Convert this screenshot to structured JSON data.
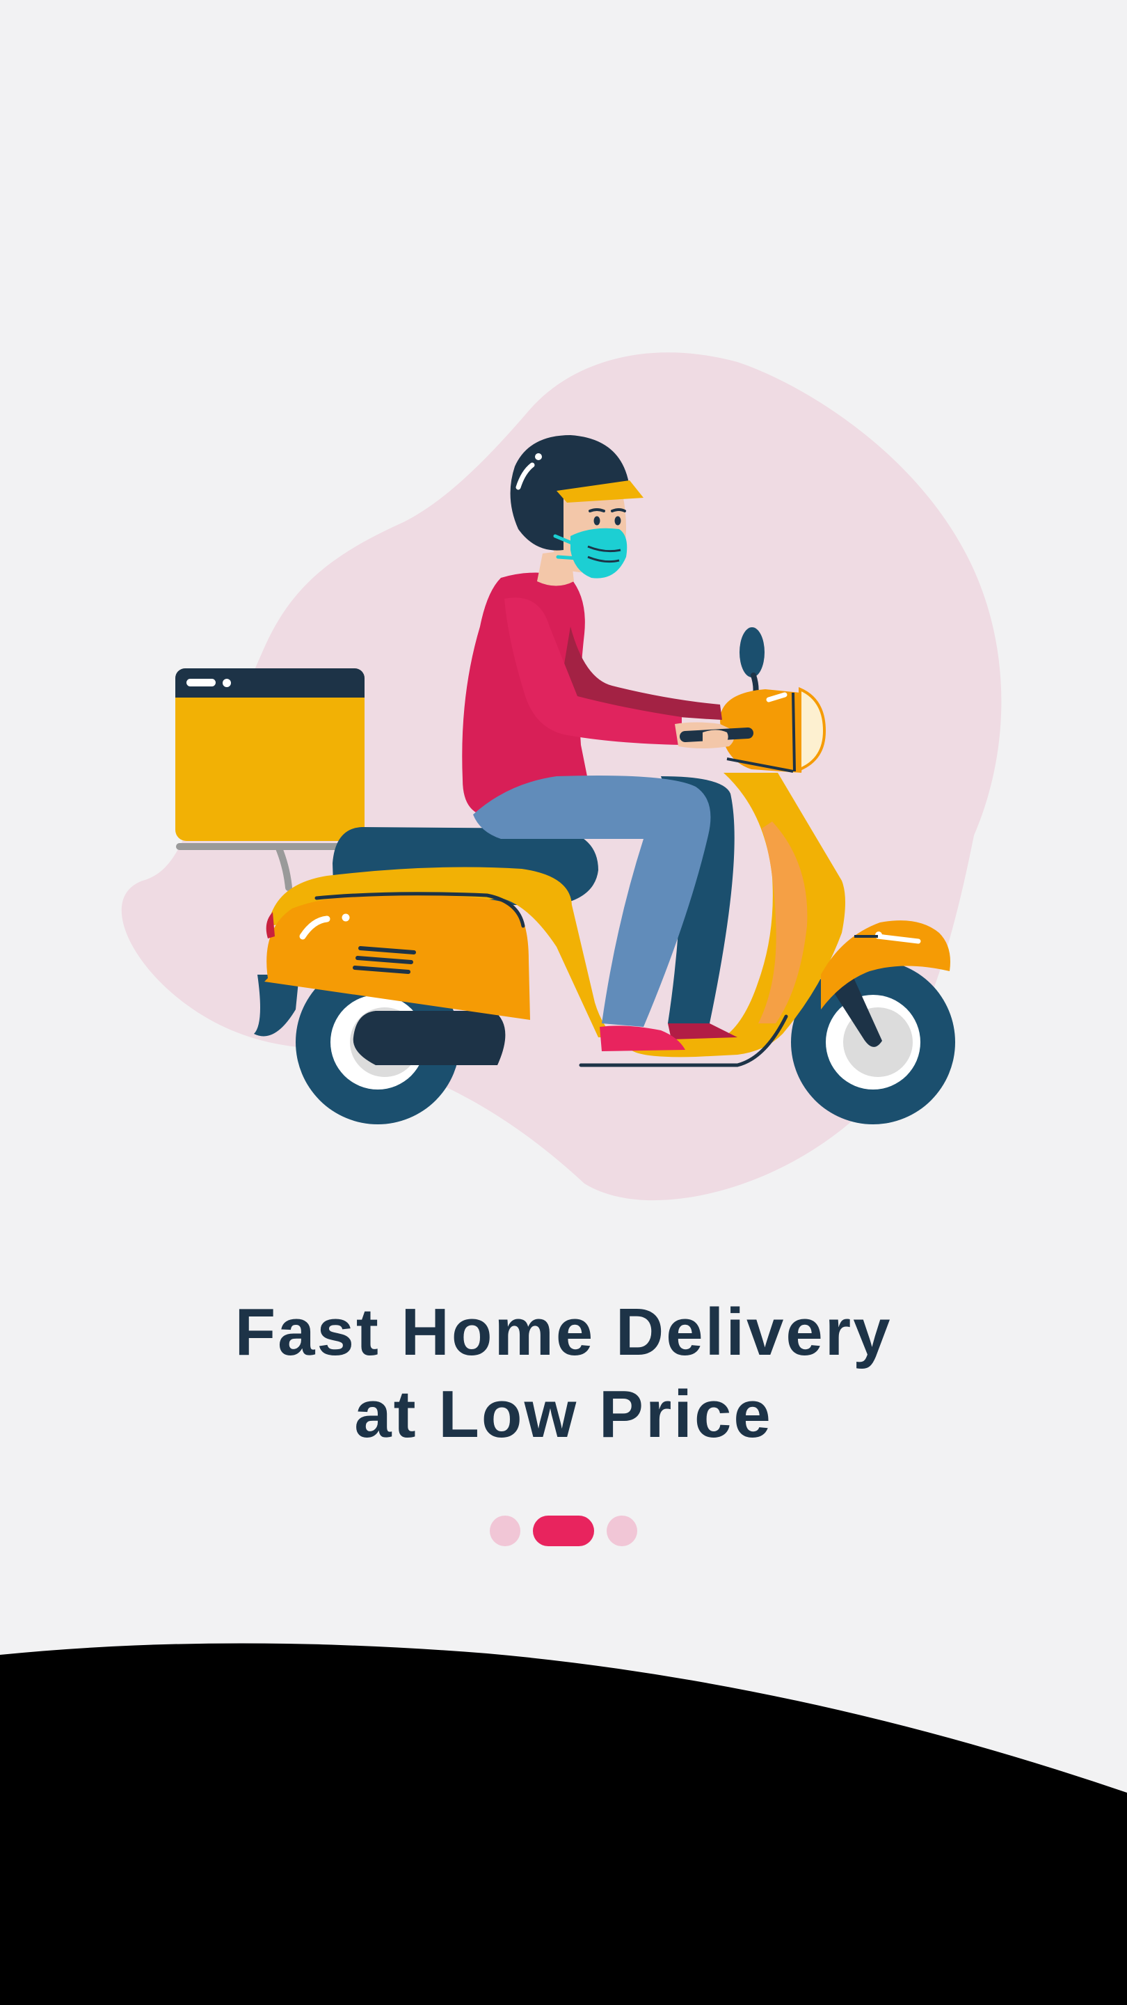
{
  "onboarding": {
    "headline_line1": "Fast Home Delivery",
    "headline_line2": "at Low Price",
    "illustration": "delivery-rider-scooter-illustration",
    "pagination": {
      "total": 3,
      "current": 2
    }
  },
  "colors": {
    "background": "#f2f2f3",
    "headline": "#1d3347",
    "accent": "#e8245e",
    "dot_inactive": "#f1c6d6",
    "blob": "#efdbe3",
    "scooter": "#f2b105",
    "scooter_shade": "#f59b05",
    "navy": "#1b4f6e",
    "shirt": "#d81f57",
    "jeans": "#618cba",
    "mask": "#1ccfd3",
    "bottom_panel": "#000000"
  }
}
